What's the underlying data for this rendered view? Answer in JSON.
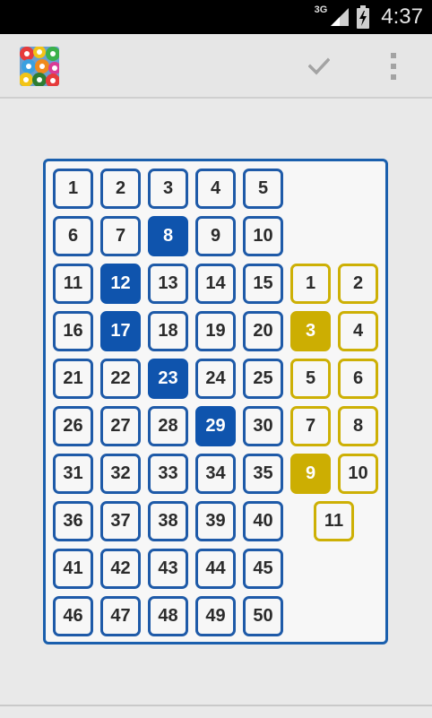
{
  "status_bar": {
    "network": "3G",
    "time": "4:37"
  },
  "action_bar": {
    "logo_icon": "lottery-balls-app-icon",
    "confirm_icon": "check-icon",
    "menu_icon": "overflow-menu-icon"
  },
  "main_numbers": [
    "1",
    "2",
    "3",
    "4",
    "5",
    "6",
    "7",
    "8",
    "9",
    "10",
    "11",
    "12",
    "13",
    "14",
    "15",
    "16",
    "17",
    "18",
    "19",
    "20",
    "21",
    "22",
    "23",
    "24",
    "25",
    "26",
    "27",
    "28",
    "29",
    "30",
    "31",
    "32",
    "33",
    "34",
    "35",
    "36",
    "37",
    "38",
    "39",
    "40",
    "41",
    "42",
    "43",
    "44",
    "45",
    "46",
    "47",
    "48",
    "49",
    "50"
  ],
  "selected_main": [
    "8",
    "12",
    "17",
    "23",
    "29"
  ],
  "star_numbers": [
    "1",
    "2",
    "3",
    "4",
    "5",
    "6",
    "7",
    "8",
    "9",
    "10",
    "11"
  ],
  "selected_stars": [
    "3",
    "9"
  ],
  "colors": {
    "main_border": "#1e5aa8",
    "main_selected": "#0f54ad",
    "star_border": "#cdb005",
    "star_selected": "#ccae02"
  }
}
